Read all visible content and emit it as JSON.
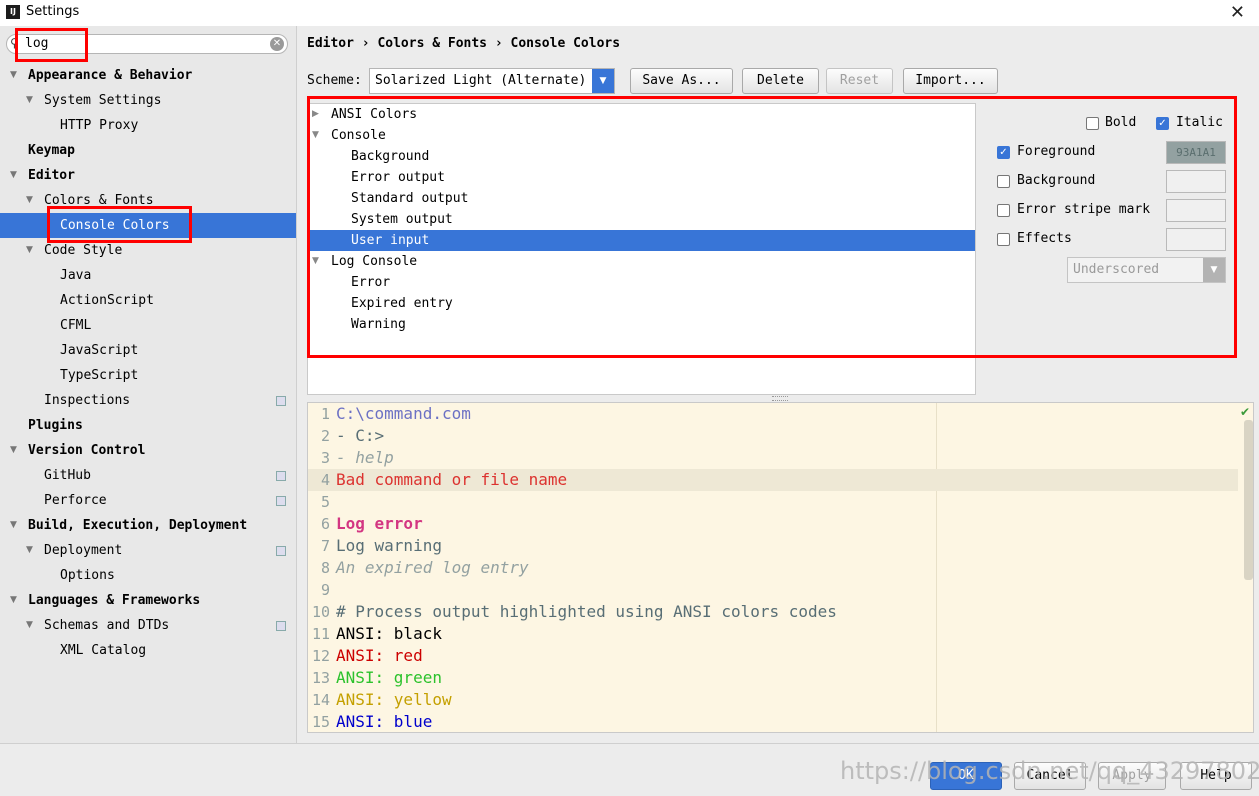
{
  "window": {
    "title": "Settings",
    "app_icon": "IJ",
    "close_glyph": "✕"
  },
  "search": {
    "value": "log"
  },
  "tree": [
    {
      "label": "Appearance & Behavior",
      "expanded": true,
      "bold": true
    },
    {
      "label": "System Settings",
      "expanded": true
    },
    {
      "label": "HTTP Proxy"
    },
    {
      "label": "Keymap",
      "bold": true
    },
    {
      "label": "Editor",
      "expanded": true,
      "bold": true
    },
    {
      "label": "Colors & Fonts",
      "expanded": true
    },
    {
      "label": "Console Colors",
      "selected": true
    },
    {
      "label": "Code Style",
      "expanded": true
    },
    {
      "label": "Java"
    },
    {
      "label": "ActionScript"
    },
    {
      "label": "CFML"
    },
    {
      "label": "JavaScript"
    },
    {
      "label": "TypeScript"
    },
    {
      "label": "Inspections",
      "project_icon": true
    },
    {
      "label": "Plugins",
      "bold": true
    },
    {
      "label": "Version Control",
      "expanded": true,
      "bold": true
    },
    {
      "label": "GitHub",
      "project_icon": true
    },
    {
      "label": "Perforce",
      "project_icon": true
    },
    {
      "label": "Build, Execution, Deployment",
      "expanded": true,
      "bold": true
    },
    {
      "label": "Deployment",
      "expanded": true,
      "project_icon": true
    },
    {
      "label": "Options"
    },
    {
      "label": "Languages & Frameworks",
      "expanded": true,
      "bold": true
    },
    {
      "label": "Schemas and DTDs",
      "expanded": true,
      "project_icon": true
    },
    {
      "label": "XML Catalog"
    }
  ],
  "breadcrumb": "Editor › Colors & Fonts › Console Colors",
  "scheme": {
    "label": "Scheme:",
    "value": "Solarized Light (Alternate)",
    "buttons": {
      "save_as": "Save As...",
      "delete": "Delete",
      "reset": "Reset",
      "import": "Import..."
    }
  },
  "elements": [
    {
      "label": "ANSI Colors",
      "arrow": "▶"
    },
    {
      "label": "Console",
      "arrow": "▼"
    },
    {
      "label": "Background"
    },
    {
      "label": "Error output"
    },
    {
      "label": "Standard output"
    },
    {
      "label": "System output"
    },
    {
      "label": "User input",
      "selected": true
    },
    {
      "label": "Log Console",
      "arrow": "▼"
    },
    {
      "label": "Error"
    },
    {
      "label": "Expired entry"
    },
    {
      "label": "Warning"
    }
  ],
  "attributes": {
    "bold": {
      "label": "Bold",
      "checked": false
    },
    "italic": {
      "label": "Italic",
      "checked": true
    },
    "foreground": {
      "label": "Foreground",
      "checked": true,
      "color": "93A1A1"
    },
    "background": {
      "label": "Background",
      "checked": false
    },
    "error_stripe": {
      "label": "Error stripe mark",
      "checked": false
    },
    "effects": {
      "label": "Effects",
      "checked": false,
      "type": "Underscored"
    }
  },
  "preview": {
    "lines": [
      {
        "n": "1",
        "text": "C:\\command.com",
        "color": "#6c71c4"
      },
      {
        "n": "2",
        "text": "- C:>",
        "color": "#586e75"
      },
      {
        "n": "3",
        "text": "- help",
        "color": "#93a1a1",
        "italic": true
      },
      {
        "n": "4",
        "text": "Bad command or file name",
        "color": "#dc322f",
        "highlighted": true
      },
      {
        "n": "5",
        "text": ""
      },
      {
        "n": "6",
        "text": "Log error",
        "color": "#d33682",
        "bold": true
      },
      {
        "n": "7",
        "text": "Log warning",
        "color": "#586e75"
      },
      {
        "n": "8",
        "text": "An expired log entry",
        "color": "#93a1a1",
        "italic": true
      },
      {
        "n": "9",
        "text": ""
      },
      {
        "n": "10",
        "text": "# Process output highlighted using ANSI colors codes",
        "color": "#586e75"
      },
      {
        "n": "11",
        "text": "ANSI: black",
        "color": "#000000"
      },
      {
        "n": "12",
        "text": "ANSI: red",
        "color": "#cc0000"
      },
      {
        "n": "13",
        "text": "ANSI: green",
        "color": "#2cc22c"
      },
      {
        "n": "14",
        "text": "ANSI: yellow",
        "color": "#c4a000"
      },
      {
        "n": "15",
        "text": "ANSI: blue",
        "color": "#0000cc"
      }
    ]
  },
  "footer": {
    "ok": "OK",
    "cancel": "Cancel",
    "apply": "Apply",
    "help": "Help"
  },
  "watermark": "https://blog.csdn.net/qq_43297802",
  "colors": {
    "accent": "#3875d7",
    "highlight_box": "#ff0000",
    "preview_bg": "#fdf6e3"
  }
}
